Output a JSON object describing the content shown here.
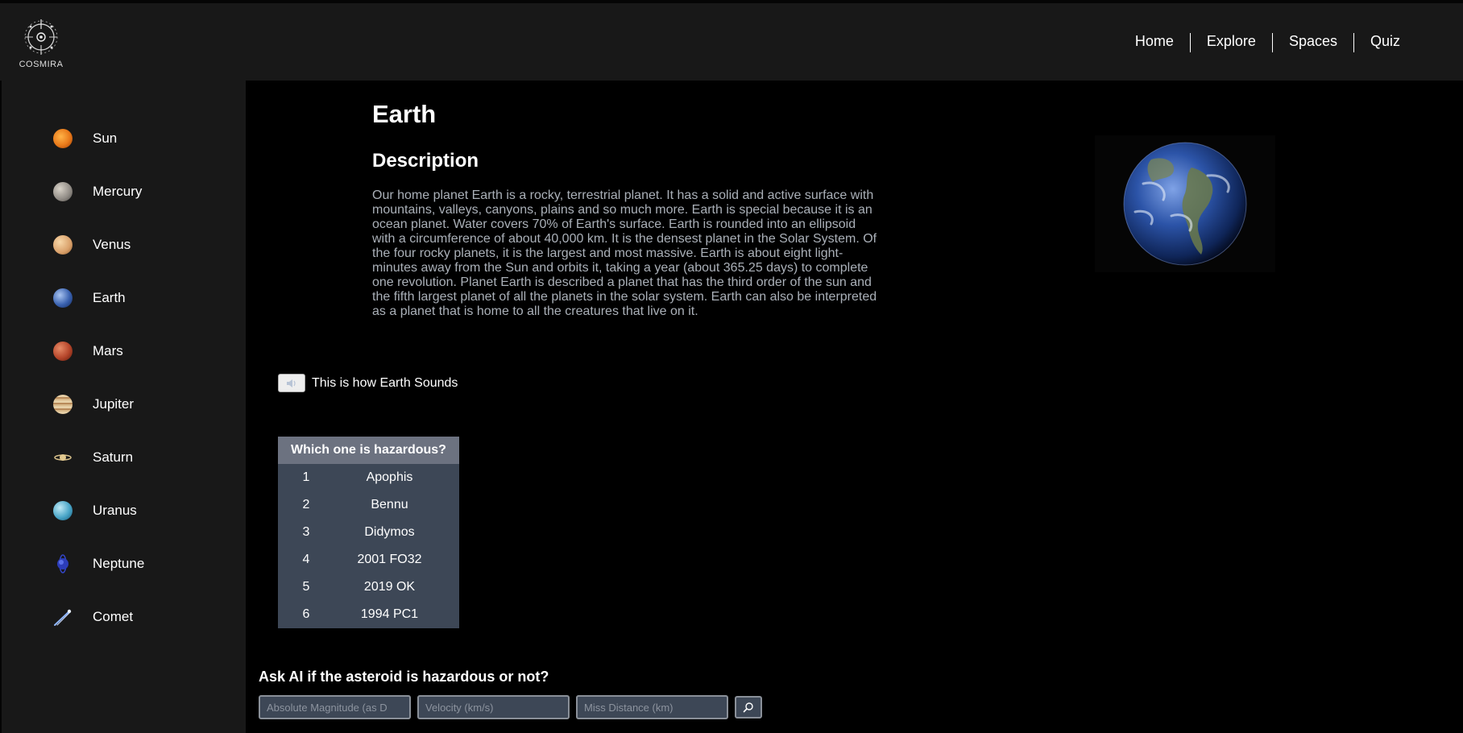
{
  "brand": {
    "name": "COSMIRA"
  },
  "nav": {
    "items": [
      {
        "label": "Home"
      },
      {
        "label": "Explore"
      },
      {
        "label": "Spaces"
      },
      {
        "label": "Quiz"
      }
    ]
  },
  "sidebar": {
    "items": [
      {
        "label": "Sun",
        "icon": "sun-icon",
        "color": "#e8791a"
      },
      {
        "label": "Mercury",
        "icon": "mercury-icon",
        "color": "#8f8a84"
      },
      {
        "label": "Venus",
        "icon": "venus-icon",
        "color": "#d9a06a"
      },
      {
        "label": "Earth",
        "icon": "earth-icon",
        "color": "#3a62b0"
      },
      {
        "label": "Mars",
        "icon": "mars-icon",
        "color": "#b5452a"
      },
      {
        "label": "Jupiter",
        "icon": "jupiter-icon",
        "color": "#c9a67a"
      },
      {
        "label": "Saturn",
        "icon": "saturn-icon",
        "color": "#d8c08a"
      },
      {
        "label": "Uranus",
        "icon": "uranus-icon",
        "color": "#4aa6c8"
      },
      {
        "label": "Neptune",
        "icon": "neptune-icon",
        "color": "#3345c8"
      },
      {
        "label": "Comet",
        "icon": "comet-icon",
        "color": "#8fb6ff"
      }
    ]
  },
  "main": {
    "title": "Earth",
    "description_heading": "Description",
    "description": "Our home planet Earth is a rocky, terrestrial planet. It has a solid and active surface with mountains, valleys, canyons, plains and so much more. Earth is special because it is an ocean planet. Water covers 70% of Earth's surface. Earth is rounded into an ellipsoid with a circumference of about 40,000 km. It is the densest planet in the Solar System. Of the four rocky planets, it is the largest and most massive. Earth is about eight light-minutes away from the Sun and orbits it, taking a year (about 365.25 days) to complete one revolution. Planet Earth is described a planet that has the third order of the sun and the fifth largest planet of all the planets in the solar system. Earth can also be interpreted as a planet that is home to all the creatures that live on it.",
    "audio_label": "This is how Earth Sounds"
  },
  "hazard_table": {
    "header": "Which one is hazardous?",
    "rows": [
      {
        "num": "1",
        "name": "Apophis"
      },
      {
        "num": "2",
        "name": "Bennu"
      },
      {
        "num": "3",
        "name": "Didymos"
      },
      {
        "num": "4",
        "name": "2001 FO32"
      },
      {
        "num": "5",
        "name": "2019 OK"
      },
      {
        "num": "6",
        "name": "1994 PC1"
      }
    ]
  },
  "ai_form": {
    "heading": "Ask AI if the asteroid is hazardous or not?",
    "magnitude_placeholder": "Absolute Magnitude (as D",
    "velocity_placeholder": "Velocity (km/s)",
    "distance_placeholder": "Miss Distance (km)"
  }
}
